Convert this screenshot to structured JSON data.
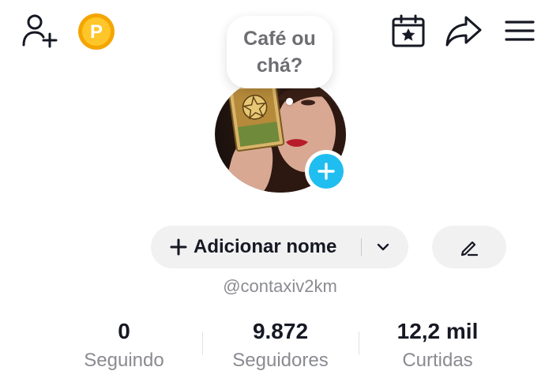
{
  "bubble": {
    "line1": "Café ou",
    "line2": "chá?"
  },
  "icons": {
    "add_friend": "add-friend-icon",
    "coin": "coin-icon",
    "calendar": "calendar-star-icon",
    "share": "share-icon",
    "menu": "hamburger-menu-icon",
    "add_photo": "plus-icon",
    "edit": "pencil-icon",
    "chevron": "chevron-down-icon"
  },
  "coin_letter": "P",
  "name_button": {
    "label": "Adicionar nome"
  },
  "username": "@contaxiv2km",
  "stats": {
    "following": {
      "value": "0",
      "label": "Seguindo"
    },
    "followers": {
      "value": "9.872",
      "label": "Seguidores"
    },
    "likes": {
      "value": "12,2 mil",
      "label": "Curtidas"
    }
  },
  "colors": {
    "accent": "#20bef0",
    "coin": "#f7b500",
    "text": "#161823",
    "muted": "#8a8b91",
    "button_bg": "#f1f1f2"
  }
}
